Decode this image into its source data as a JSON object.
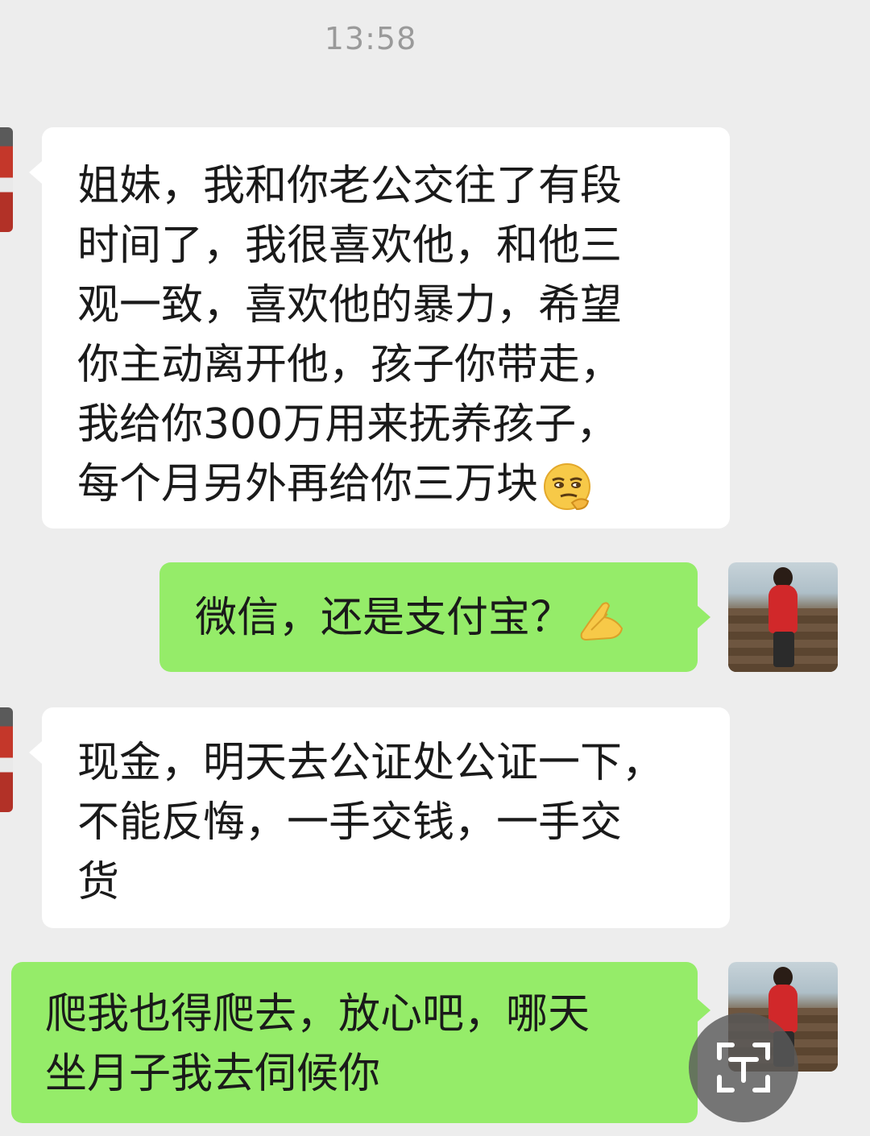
{
  "chat": {
    "timestamp": "13:58",
    "messages": [
      {
        "side": "in",
        "lines": [
          "姐妹，我和你老公交往了有段",
          "时间了，我很喜欢他，和他三",
          "观一致，喜欢他的暴力，希望",
          "你主动离开他，孩子你带走，",
          "我给你300万用来抚养孩子，",
          "每个月另外再给你三万块"
        ],
        "emoji": "smirk-face"
      },
      {
        "side": "out",
        "lines": [
          "微信，还是支付宝？"
        ],
        "emoji": "pinched-fingers-hand"
      },
      {
        "side": "in",
        "lines": [
          "现金，明天去公证处公证一下，",
          "不能反悔，一手交钱，一手交",
          "货"
        ]
      },
      {
        "side": "out",
        "lines": [
          "爬我也得爬去，放心吧，哪天",
          "坐月子我去伺候你"
        ]
      }
    ]
  },
  "colors": {
    "background": "#ededed",
    "incoming_bubble": "#ffffff",
    "outgoing_bubble": "#95ec69",
    "timestamp_text": "#9a9a9a"
  }
}
